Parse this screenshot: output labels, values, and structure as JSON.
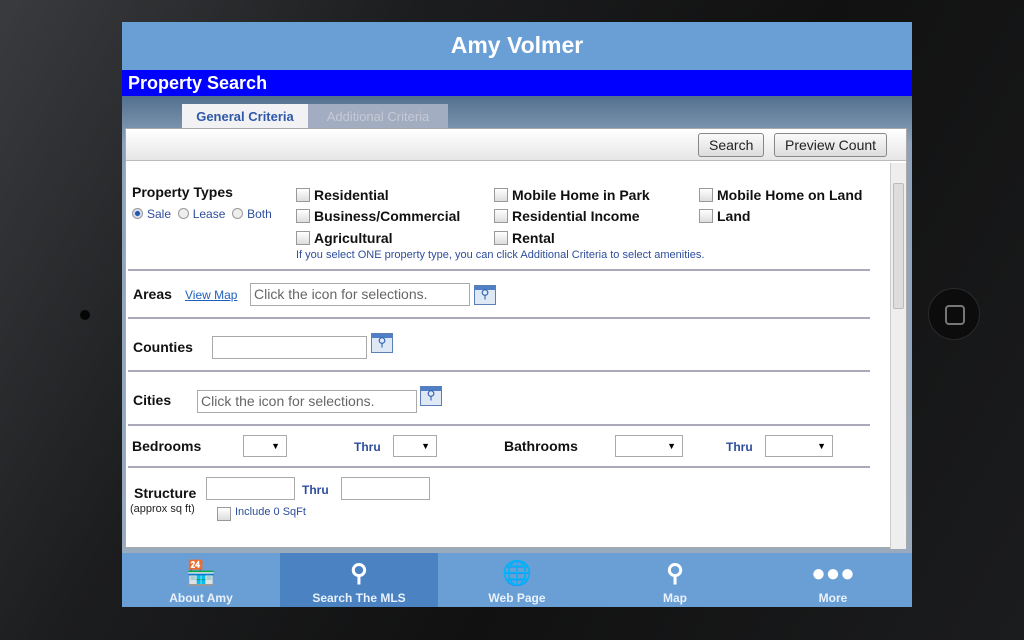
{
  "header": {
    "title": "Amy Volmer"
  },
  "section_title": "Property Search",
  "tabs": [
    {
      "label": "General Criteria",
      "active": true
    },
    {
      "label": "Additional Criteria",
      "active": false
    }
  ],
  "toolbar": {
    "search": "Search",
    "preview": "Preview Count"
  },
  "property_types": {
    "label": "Property Types",
    "radios": [
      {
        "label": "Sale",
        "checked": true
      },
      {
        "label": "Lease",
        "checked": false
      },
      {
        "label": "Both",
        "checked": false
      }
    ],
    "options": [
      "Residential",
      "Business/Commercial",
      "Agricultural",
      "Mobile Home in Park",
      "Residential Income",
      "Rental",
      "Mobile Home on Land",
      "Land"
    ],
    "hint": "If you select ONE property type, you can click Additional Criteria to select amenities."
  },
  "areas": {
    "label": "Areas",
    "link": "View Map",
    "placeholder": "Click the icon for selections."
  },
  "counties": {
    "label": "Counties",
    "value": ""
  },
  "cities": {
    "label": "Cities",
    "placeholder": "Click the icon for selections."
  },
  "rooms": {
    "bedrooms": "Bedrooms",
    "bathrooms": "Bathrooms",
    "thru": "Thru"
  },
  "structure": {
    "label": "Structure",
    "sub": "(approx sq ft)",
    "thru": "Thru",
    "include": "Include 0 SqFt"
  },
  "nav": [
    {
      "label": "About Amy",
      "icon": "store-icon"
    },
    {
      "label": "Search The MLS",
      "icon": "search-icon",
      "active": true
    },
    {
      "label": "Web Page",
      "icon": "globe-icon"
    },
    {
      "label": "Map",
      "icon": "map-pin-icon"
    },
    {
      "label": "More",
      "icon": "more-icon"
    }
  ]
}
